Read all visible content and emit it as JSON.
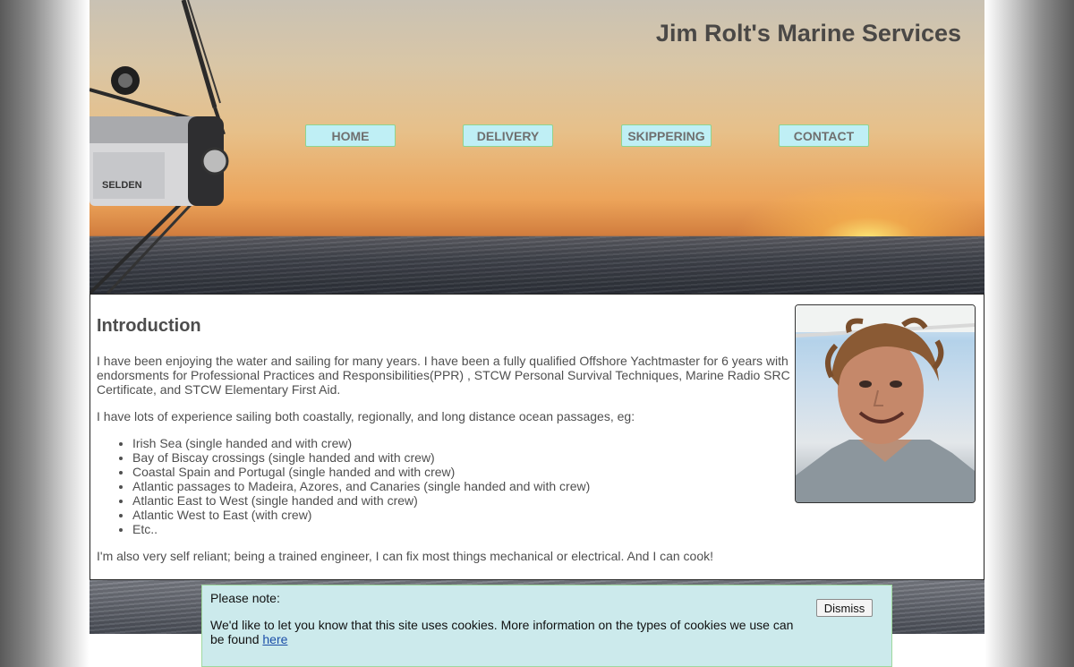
{
  "header": {
    "site_title": "Jim Rolt's Marine Services",
    "boom_label": "SELDEN"
  },
  "nav": {
    "items": [
      {
        "label": "HOME"
      },
      {
        "label": "DELIVERY"
      },
      {
        "label": "SKIPPERING"
      },
      {
        "label": "CONTACT"
      }
    ]
  },
  "main": {
    "heading": "Introduction",
    "paragraph1": "I have been enjoying the water and sailing for many years. I have been a fully qualified Offshore Yachtmaster for 6 years with endorsments for Professional Practices and Responsibilities(PPR) , STCW Personal Survival Techniques, Marine Radio SRC Certificate, and STCW Elementary First Aid.",
    "paragraph2": "I have lots of experience sailing both coastally, regionally, and long distance ocean passages, eg:",
    "passages": [
      "Irish Sea (single handed and with crew)",
      "Bay of Biscay crossings (single handed and with crew)",
      "Coastal Spain and Portugal (single handed and with crew)",
      "Atlantic passages to Madeira, Azores, and Canaries (single handed and with crew)",
      "Atlantic East to West (single handed and with crew)",
      "Atlantic West to East (with crew)",
      "Etc.."
    ],
    "paragraph3": "I'm also very self reliant; being a trained engineer, I can fix most things mechanical or electrical. And I can cook!"
  },
  "cookie_banner": {
    "title": "Please note:",
    "text": "We'd like to let you know that this site uses cookies. More information on the types of cookies we use can be found ",
    "link_label": "here",
    "dismiss_label": "Dismiss"
  },
  "colors": {
    "nav_button_bg": "#bfeff5",
    "nav_button_border": "#8fd48f",
    "cookie_bg": "#cceaec",
    "title_text": "#4a4846"
  }
}
